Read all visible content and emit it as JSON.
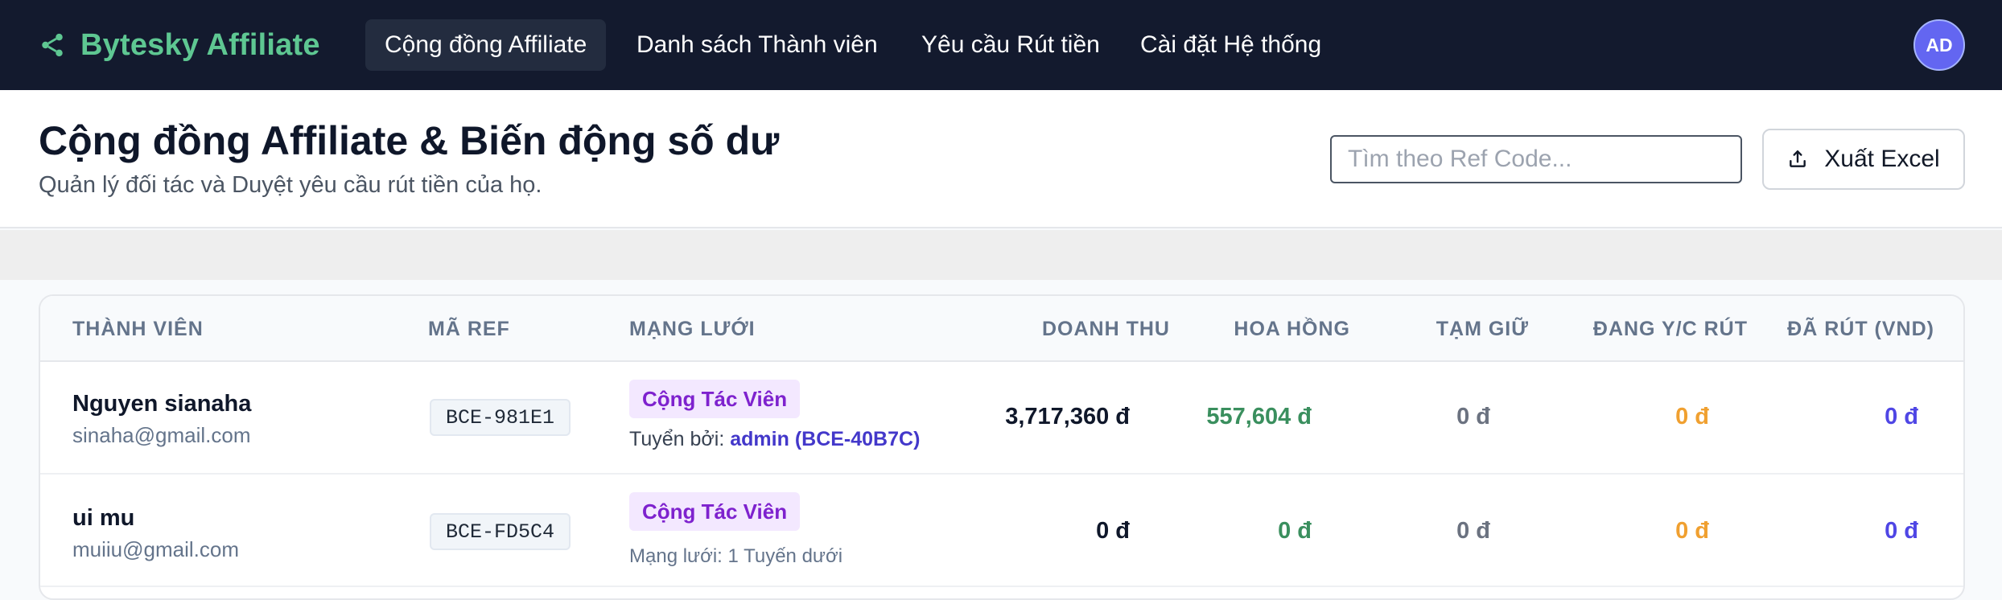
{
  "brand": {
    "name": "Bytesky Affiliate",
    "icon": "share-icon",
    "color": "#5ec792"
  },
  "nav": {
    "tabs": [
      {
        "label": "Cộng đồng Affiliate",
        "active": true
      },
      {
        "label": "Danh sách Thành viên",
        "active": false
      },
      {
        "label": "Yêu cầu Rút tiền",
        "active": false
      },
      {
        "label": "Cài đặt Hệ thống",
        "active": false
      }
    ],
    "avatar_initials": "AD"
  },
  "header": {
    "title": "Cộng đồng Affiliate & Biến động số dư",
    "subtitle": "Quản lý đối tác và Duyệt yêu cầu rút tiền của họ.",
    "search_placeholder": "Tìm theo Ref Code...",
    "export_label": "Xuất Excel",
    "export_icon": "upload-icon"
  },
  "table": {
    "columns": [
      "THÀNH VIÊN",
      "MÃ REF",
      "MẠNG LƯỚI",
      "DOANH THU",
      "HOA HỒNG",
      "TẠM GIỮ",
      "ĐANG Y/C RÚT",
      "ĐÃ RÚT (VND)"
    ],
    "rows": [
      {
        "name": "Nguyen sianaha",
        "email": "sinaha@gmail.com",
        "ref": "BCE-981E1",
        "role": "Cộng Tác Viên",
        "network_prefix": "Tuyển bởi: ",
        "network_highlight": "admin (BCE-40B7C)",
        "revenue": "3,717,360 đ",
        "commission": "557,604 đ",
        "held": "0 đ",
        "pending_withdraw": "0 đ",
        "withdrawn": "0 đ"
      },
      {
        "name": "ui mu",
        "email": "muiiu@gmail.com",
        "ref": "BCE-FD5C4",
        "role": "Cộng Tác Viên",
        "network_note": "Mạng lưới: 1 Tuyến dưới",
        "revenue": "0 đ",
        "commission": "0 đ",
        "held": "0 đ",
        "pending_withdraw": "0 đ",
        "withdrawn": "0 đ"
      }
    ]
  },
  "colors": {
    "nav_bg": "#131a2e",
    "commission": "#3a8f5e",
    "held": "#6b7280",
    "pending": "#f0a030",
    "withdrawn": "#4f46e5",
    "badge_bg": "#f3e8ff",
    "badge_text": "#7e22ce",
    "avatar": "#6366f1"
  }
}
